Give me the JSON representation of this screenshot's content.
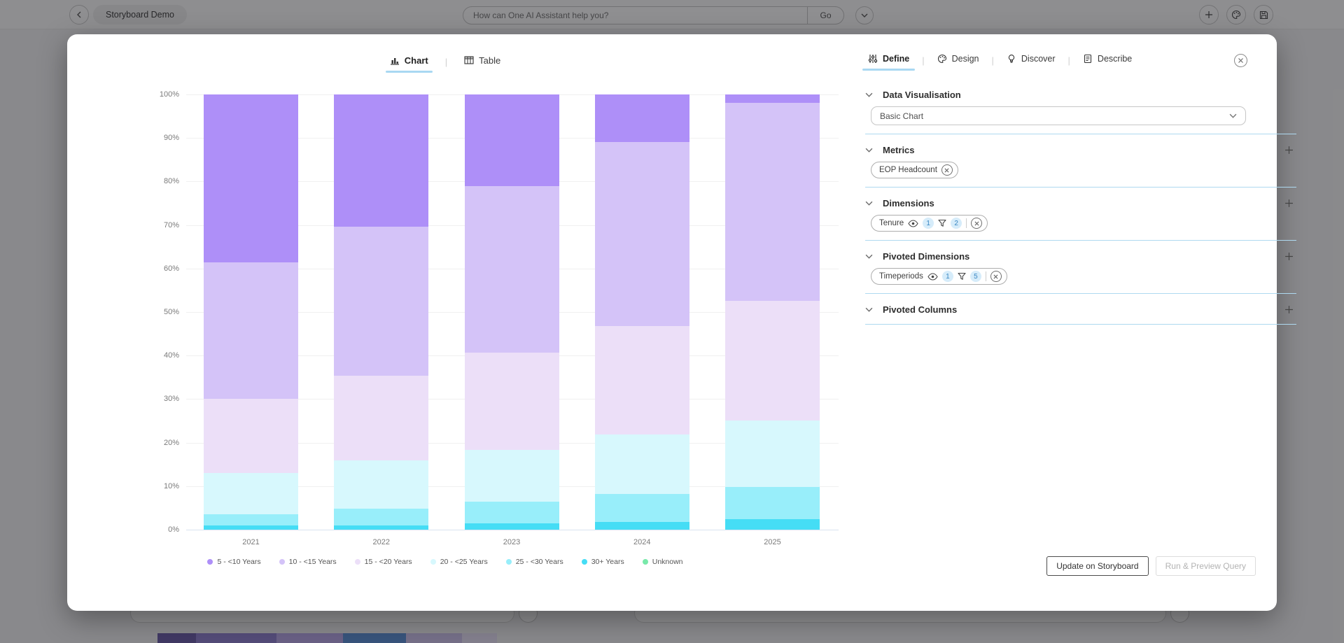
{
  "topbar": {
    "board_title": "Storyboard Demo",
    "assistant_placeholder": "How can One AI Assistant help you?",
    "go_label": "Go"
  },
  "modal": {
    "view_tabs": [
      {
        "label": "Chart",
        "icon": "bar-chart-icon",
        "active": true
      },
      {
        "label": "Table",
        "icon": "table-icon",
        "active": false
      }
    ],
    "panel_tabs": [
      {
        "label": "Define",
        "icon": "sliders-icon",
        "active": true
      },
      {
        "label": "Design",
        "icon": "palette-icon",
        "active": false
      },
      {
        "label": "Discover",
        "icon": "lightbulb-icon",
        "active": false
      },
      {
        "label": "Describe",
        "icon": "document-icon",
        "active": false
      }
    ],
    "sections": [
      {
        "title": "Data Visualisation",
        "add_button": false,
        "control": {
          "type": "select",
          "value": "Basic Chart"
        },
        "pills": []
      },
      {
        "title": "Metrics",
        "add_button": true,
        "pills": [
          {
            "label": "EOP Headcount",
            "removable": true
          }
        ]
      },
      {
        "title": "Dimensions",
        "add_button": true,
        "pills": [
          {
            "label": "Tenure",
            "eye": true,
            "eye_count": "1",
            "filter": true,
            "filter_count": "2",
            "removable": true
          }
        ]
      },
      {
        "title": "Pivoted Dimensions",
        "add_button": true,
        "pills": [
          {
            "label": "Timeperiods",
            "eye": true,
            "eye_count": "1",
            "filter": true,
            "filter_count": "5",
            "removable": true
          }
        ]
      },
      {
        "title": "Pivoted Columns",
        "add_button": true,
        "pills": []
      }
    ],
    "footer": {
      "update_label": "Update on Storyboard",
      "run_label": "Run & Preview Query"
    }
  },
  "chart_data": {
    "type": "bar",
    "stacked": true,
    "percent": true,
    "title": "",
    "xlabel": "",
    "ylabel": "",
    "ylim": [
      0,
      100
    ],
    "ytick_step": 10,
    "grid": true,
    "legend_position": "bottom",
    "categories": [
      "2021",
      "2022",
      "2023",
      "2024",
      "2025"
    ],
    "series": [
      {
        "name": "5 - <10 Years",
        "color": "#ae8ff8",
        "values": [
          38.6,
          30.4,
          21.0,
          10.9,
          2.0
        ]
      },
      {
        "name": "10 - <15 Years",
        "color": "#d4c3f8",
        "values": [
          31.4,
          34.2,
          38.4,
          42.3,
          45.5
        ]
      },
      {
        "name": "15 - <20 Years",
        "color": "#ecdff8",
        "values": [
          17.0,
          19.5,
          22.2,
          25.0,
          27.4
        ]
      },
      {
        "name": "20 - <25 Years",
        "color": "#d7f8fd",
        "values": [
          9.4,
          11.1,
          12.0,
          13.6,
          15.3
        ]
      },
      {
        "name": "25 - <30 Years",
        "color": "#98eefa",
        "values": [
          2.7,
          3.8,
          5.0,
          6.4,
          7.4
        ]
      },
      {
        "name": "30+ Years",
        "color": "#45ddf5",
        "values": [
          0.9,
          1.0,
          1.4,
          1.8,
          2.4
        ]
      },
      {
        "name": "Unknown",
        "color": "#79e9aa",
        "values": [
          0,
          0,
          0,
          0,
          0
        ]
      }
    ],
    "note": "100% stacked bar; first series renders at top of each stack"
  },
  "colors": {
    "accent_underline": "#a9d8f2",
    "section_divider": "#aed9f0",
    "badge_bg": "#d6ecfa",
    "badge_text": "#3a87c2"
  },
  "background_page": {
    "mini_bar_segments": [
      "#6b5ca8",
      "#8f7fd0",
      "#b7a7e8",
      "#5a8fd6",
      "#cfc3ef",
      "#e8e0f8"
    ]
  }
}
